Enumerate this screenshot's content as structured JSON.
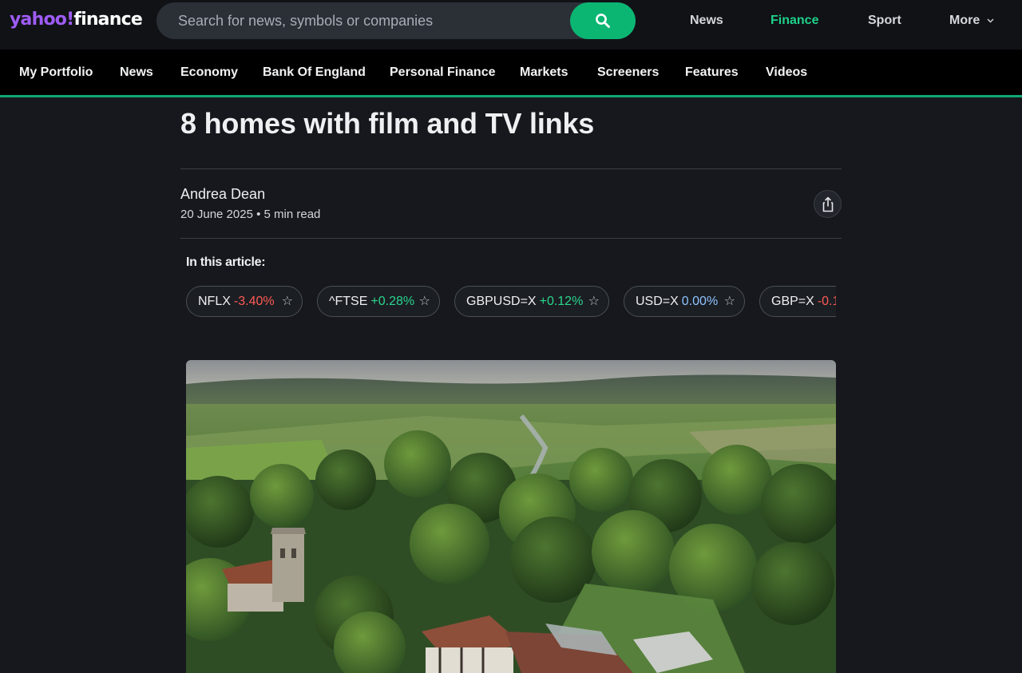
{
  "header": {
    "logo_brand": "yahoo",
    "logo_bang": "!",
    "logo_product": "finance",
    "search_placeholder": "Search for news, symbols or companies",
    "links": [
      {
        "label": "News"
      },
      {
        "label": "Finance",
        "active": true
      },
      {
        "label": "Sport"
      },
      {
        "label": "More"
      }
    ]
  },
  "subnav": {
    "items": [
      "My Portfolio",
      "News",
      "Economy",
      "Bank Of England",
      "Personal Finance",
      "Markets",
      "Screeners",
      "Features",
      "Videos"
    ]
  },
  "article": {
    "title": "8 homes with film and TV links",
    "author": "Andrea Dean",
    "date": "20 June 2025",
    "separator": "•",
    "read_time": "5 min read",
    "in_this_article": "In this article:",
    "tickers": [
      {
        "symbol": "NFLX",
        "change": "-3.40%",
        "direction": "negative"
      },
      {
        "symbol": "^FTSE",
        "change": "+0.28%",
        "direction": "positive"
      },
      {
        "symbol": "GBPUSD=X",
        "change": "+0.12%",
        "direction": "positive"
      },
      {
        "symbol": "USD=X",
        "change": "0.00%",
        "direction": "flat"
      },
      {
        "symbol": "GBP=X",
        "change": "-0.1",
        "direction": "negative"
      }
    ]
  },
  "icons": {
    "search": "search-icon",
    "share": "share-icon",
    "star": "star-icon",
    "caret": "chevron-down-icon"
  },
  "colors": {
    "brand_purple": "#9f5cf5",
    "accent_green": "#0bb673",
    "negative": "#ff5b54",
    "positive": "#2bd68e",
    "flat": "#8ec3ff"
  }
}
